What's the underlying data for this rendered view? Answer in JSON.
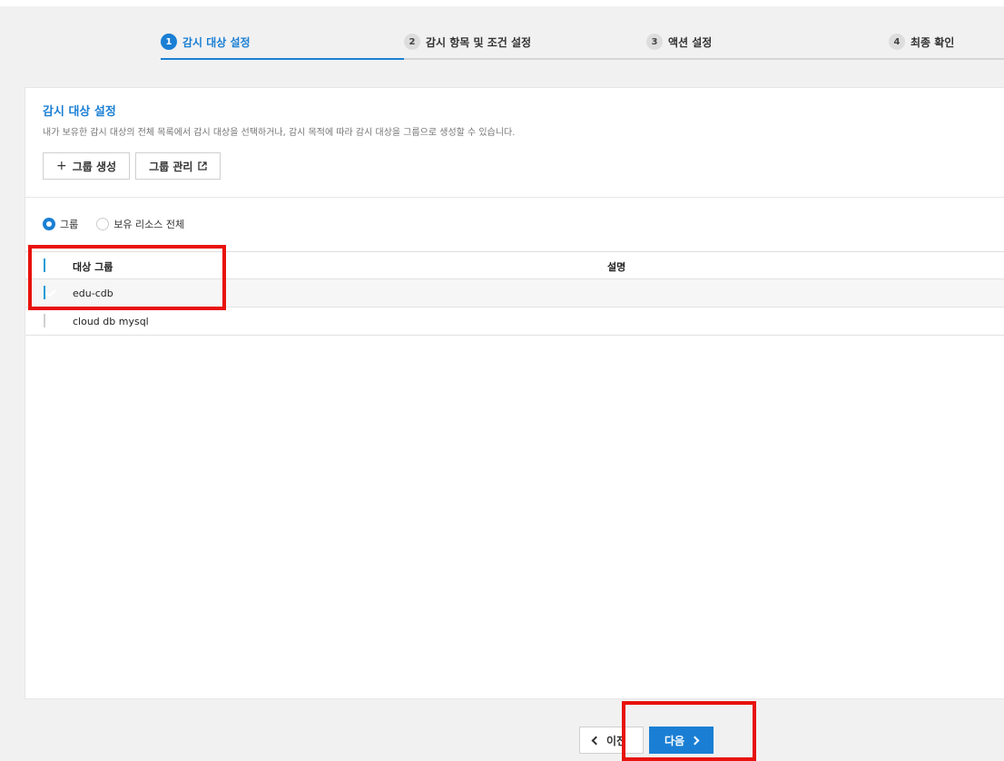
{
  "stepper": {
    "steps": [
      {
        "num": "1",
        "label": "감시 대상 설정"
      },
      {
        "num": "2",
        "label": "감시 항목 및 조건 설정"
      },
      {
        "num": "3",
        "label": "액션 설정"
      },
      {
        "num": "4",
        "label": "최종 확인"
      }
    ]
  },
  "card": {
    "title": "감시 대상 설정",
    "description": "내가 보유한 감시 대상의 전체 목록에서 감시 대상을 선택하거나, 감시 목적에 따라 감시 대상을 그룹으로 생성할 수 있습니다.",
    "buttons": {
      "create_group": "그룹 생성",
      "manage_group": "그룹 관리"
    }
  },
  "radio": {
    "group": "그룹",
    "all_resources": "보유 리소스 전체",
    "selected": "group"
  },
  "table": {
    "headers": {
      "name": "대상 그룹",
      "desc": "설명"
    },
    "rows": [
      {
        "name": "edu-cdb",
        "desc": "",
        "checked": true
      },
      {
        "name": "cloud db mysql",
        "desc": "",
        "checked": false
      }
    ]
  },
  "nav": {
    "prev_label": "이전",
    "next_label": "다음"
  },
  "colors": {
    "accent": "#1a7fd4",
    "checkbox": "#1a9ad6",
    "annotation": "#e8120c"
  }
}
